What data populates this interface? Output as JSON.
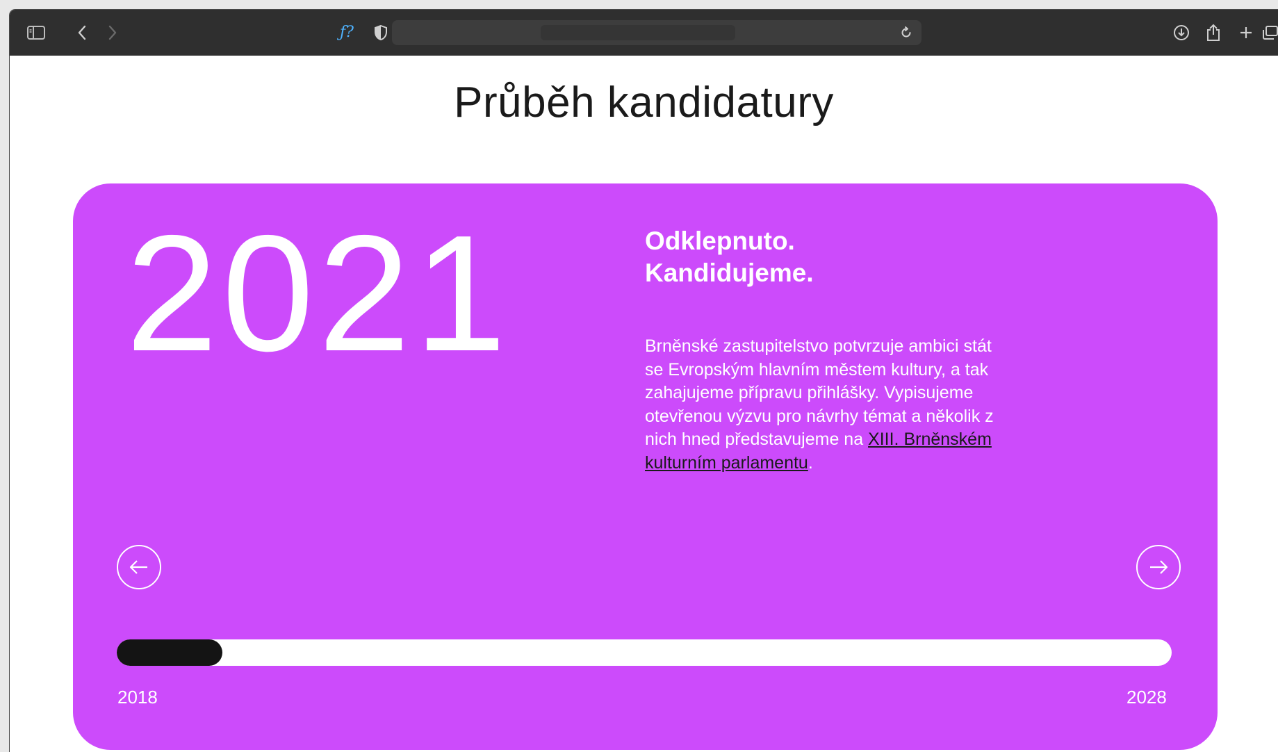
{
  "browser": {
    "url": "",
    "icons": [
      "sidebar-icon",
      "back-icon",
      "forward-icon",
      "fx-icon",
      "shield-icon",
      "reload-icon",
      "download-icon",
      "share-icon",
      "new-tab-icon",
      "tabs-overview-icon"
    ],
    "fx_label": "ƒ?"
  },
  "page": {
    "title": "Průběh kandidatury"
  },
  "timeline_card": {
    "background_color": "#cc4bfb",
    "year": "2021",
    "headline_line1": "Odklepnuto.",
    "headline_line2": "Kandidujeme.",
    "body_before_link": "Brněnské zastupitelstvo potvrzuje ambici stát se Evropským hlavním městem kultury, a tak zahajujeme přípravu přihlášky. Vypisujeme otevřenou výzvu pro návrhy témat a několik z nich hned představujeme na ",
    "body_link": "XIII. Brněnském kulturním parlamentu",
    "body_after_link": ".",
    "prev_icon": "arrow-left-icon",
    "next_icon": "arrow-right-icon",
    "timeline_start": "2018",
    "timeline_end": "2028",
    "progress_fraction": 0.1
  }
}
